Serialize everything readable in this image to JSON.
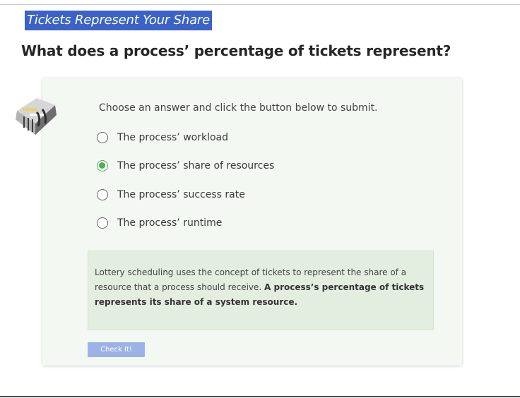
{
  "section": {
    "title": "Tickets Represent Your Share"
  },
  "question": {
    "text": "What does a process’ percentage of tickets represent?"
  },
  "quiz": {
    "instructions": "Choose an answer and click the button below to submit.",
    "options": [
      {
        "label": "The process’ workload",
        "selected": false
      },
      {
        "label": "The process’ share of resources",
        "selected": true
      },
      {
        "label": "The process’ success rate",
        "selected": false
      },
      {
        "label": "The process’ runtime",
        "selected": false
      }
    ],
    "explanation": {
      "text": "Lottery scheduling uses the concept of tickets to represent the share of a resource that a process should receive. ",
      "bold": "A process’s percentage of tickets represents its share of a system resource."
    },
    "button_label": "Check It!"
  },
  "colors": {
    "title_bg": "#3b62c7",
    "card_bg": "#f3f8f2",
    "correct_green": "#4caf50",
    "explanation_bg": "#e3ede0",
    "button_bg": "#9db3e6"
  },
  "icons": {
    "mascot": "stair-building-mascot-icon",
    "selected_radio": "check-circle-icon"
  }
}
